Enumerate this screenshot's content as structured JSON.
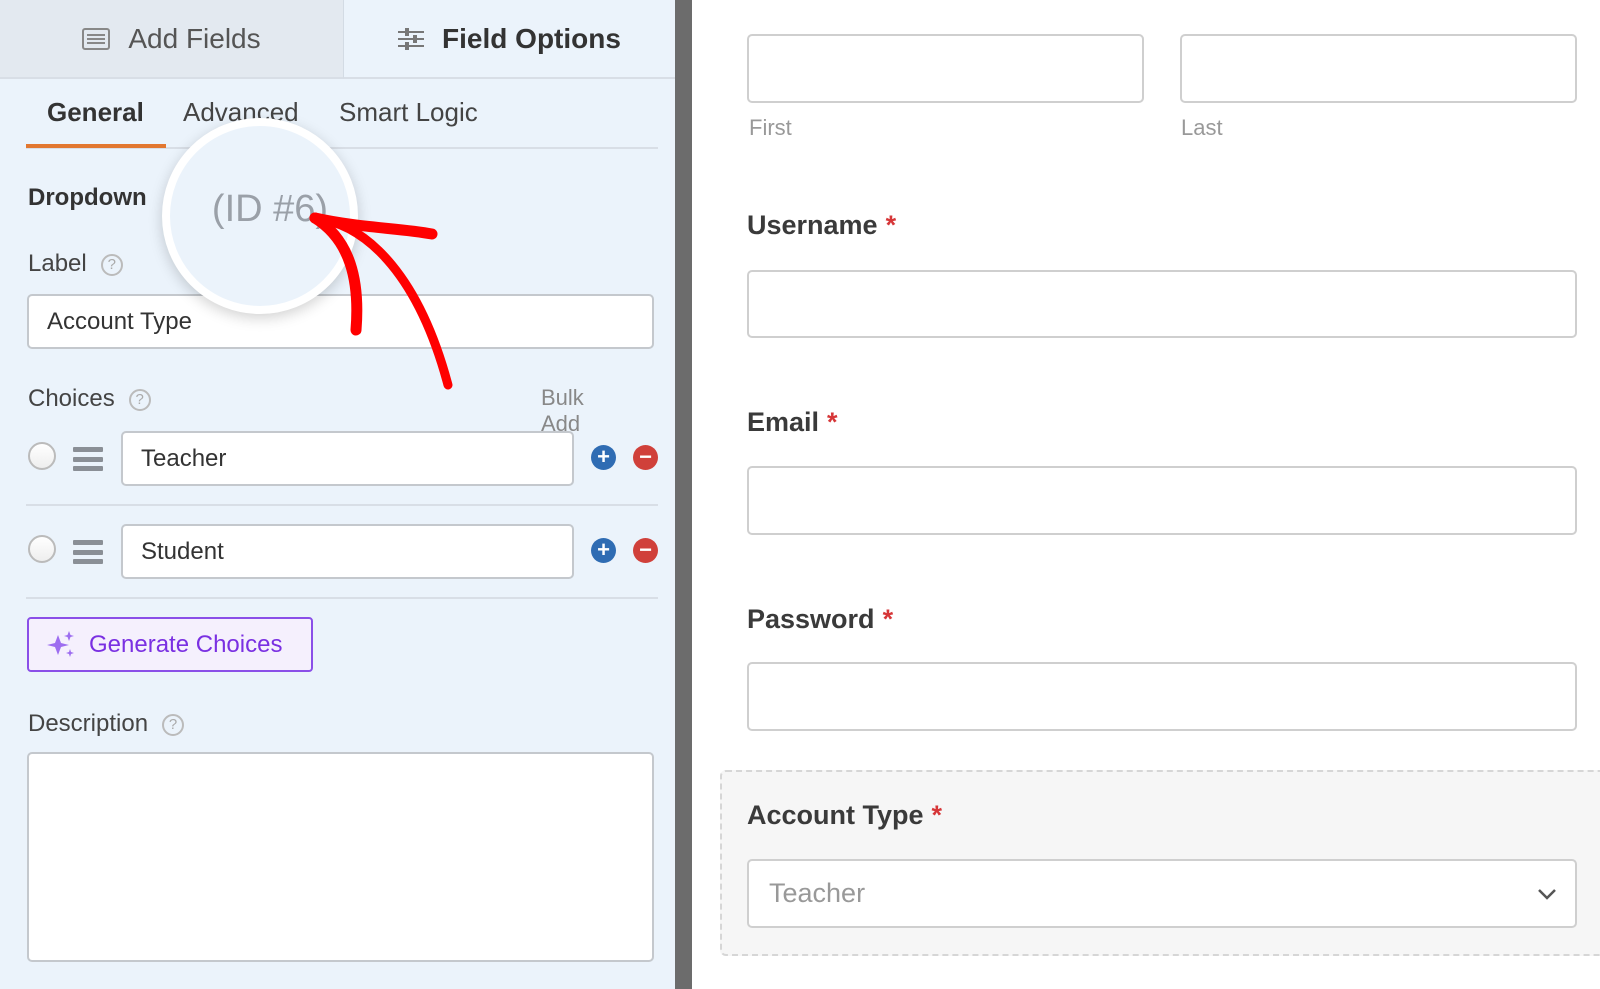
{
  "left_panel": {
    "tabs": {
      "add_fields": "Add Fields",
      "field_options": "Field Options"
    },
    "subtabs": [
      "General",
      "Advanced",
      "Smart Logic"
    ],
    "field_title": "Dropdown",
    "field_id": "(ID #6)",
    "label": {
      "title": "Label",
      "value": "Account Type"
    },
    "choices": {
      "title": "Choices",
      "bulk_add": "Bulk Add",
      "items": [
        "Teacher",
        "Student"
      ]
    },
    "generate_button": "Generate Choices",
    "description": {
      "title": "Description",
      "value": ""
    },
    "help_glyph": "?"
  },
  "preview": {
    "name_sublabels": [
      "First",
      "Last"
    ],
    "fields": [
      {
        "label": "Username",
        "required": "*"
      },
      {
        "label": "Email",
        "required": "*"
      },
      {
        "label": "Password",
        "required": "*"
      }
    ],
    "dropdown": {
      "label": "Account Type",
      "required": "*",
      "value": "Teacher"
    }
  },
  "colors": {
    "accent": "#e27730",
    "annotation": "#ff0000",
    "generate": "#7a30e2",
    "add": "#2f6cb3",
    "remove": "#d0403a",
    "required": "#d63638"
  }
}
